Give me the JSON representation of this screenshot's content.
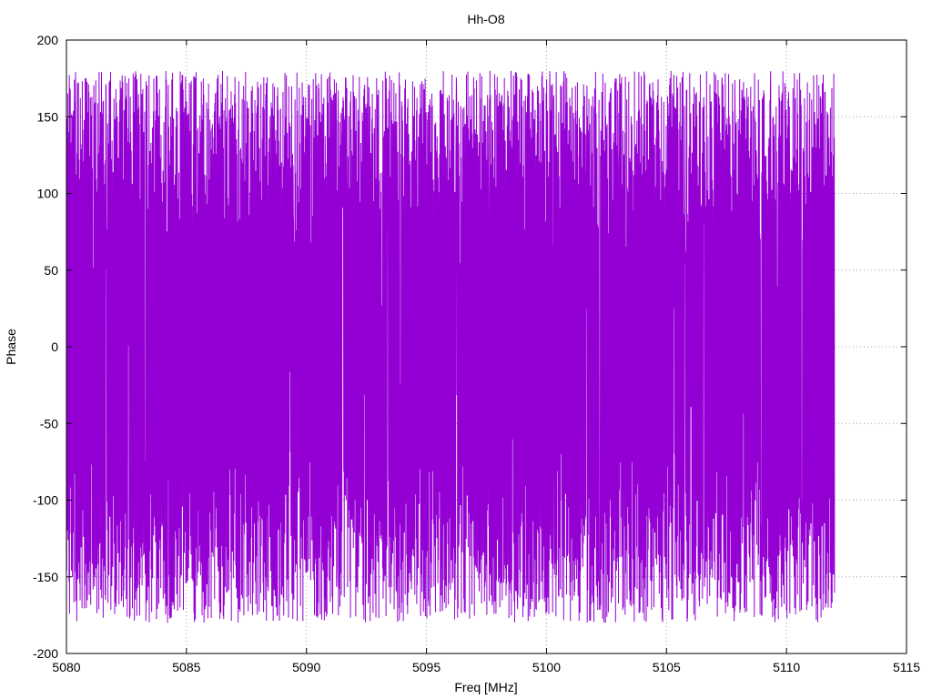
{
  "chart_data": {
    "type": "line",
    "title": "Hh-O8",
    "xlabel": "Freq [MHz]",
    "ylabel": "Phase",
    "xlim": [
      5080,
      5115
    ],
    "ylim": [
      -200,
      200
    ],
    "x_ticks": [
      5080,
      5085,
      5090,
      5095,
      5100,
      5105,
      5110,
      5115
    ],
    "y_ticks": [
      -200,
      -150,
      -100,
      -50,
      0,
      50,
      100,
      150,
      200
    ],
    "grid": true,
    "legend": "none",
    "series": [
      {
        "color": "#9400d3",
        "x_start": 5080,
        "x_end": 5112,
        "value_range": [
          -180,
          180
        ],
        "pattern": "dense oscillating phase data wrapping between -180 and 180"
      }
    ]
  }
}
